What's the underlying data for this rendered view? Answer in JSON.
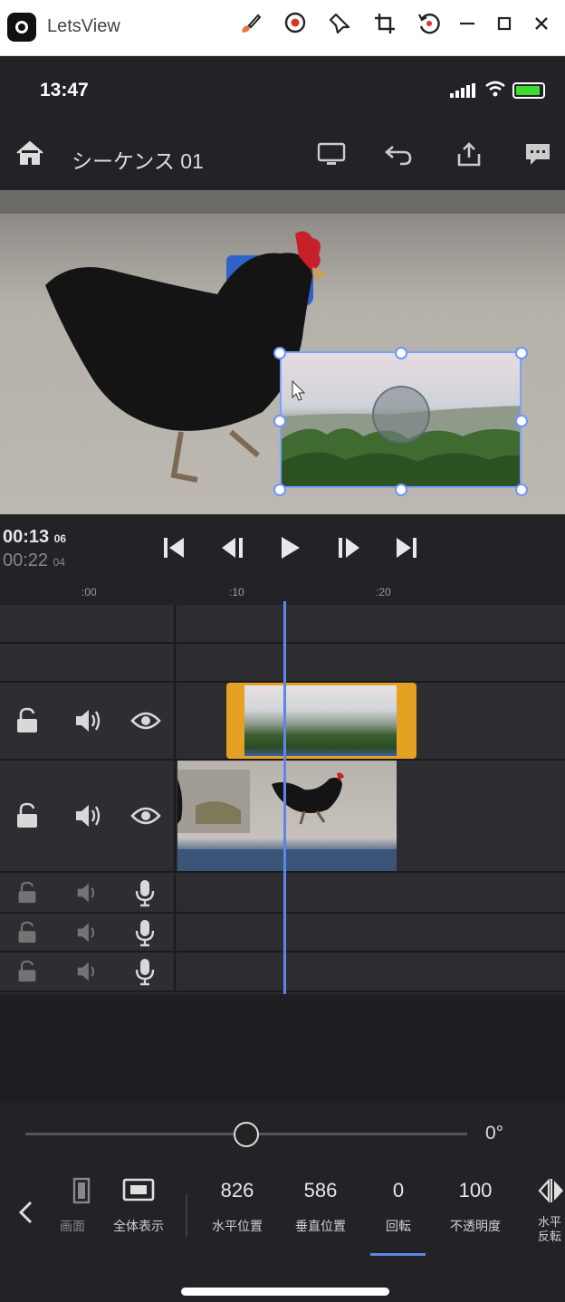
{
  "window": {
    "app_title": "LetsView",
    "toolbar_icons": [
      "brush-icon",
      "record-icon",
      "pin-icon",
      "crop-icon",
      "rotate-icon",
      "minimize-icon",
      "maximize-icon",
      "close-icon"
    ]
  },
  "status_bar": {
    "time": "13:47"
  },
  "header": {
    "sequence_title": "シーケンス 01"
  },
  "transport": {
    "current_time": "00:13",
    "current_frames": "06",
    "total_time": "00:22",
    "total_frames": "04"
  },
  "ruler": {
    "ticks": [
      ":00",
      ":10",
      ":20"
    ]
  },
  "controls": {
    "rotation_display": "0°",
    "rotation_value": 0,
    "params": [
      {
        "value": "",
        "label": "画面"
      },
      {
        "value": "",
        "label": "全体表示"
      },
      {
        "value": "826",
        "label": "水平位置"
      },
      {
        "value": "586",
        "label": "垂直位置"
      },
      {
        "value": "0",
        "label": "回転"
      },
      {
        "value": "100",
        "label": "不透明度"
      },
      {
        "value": "",
        "label": "水平反転"
      }
    ],
    "active_param": "回転"
  },
  "colors": {
    "accent": "#5e86e8",
    "clip_selected": "#e5a124",
    "background": "#232226"
  }
}
